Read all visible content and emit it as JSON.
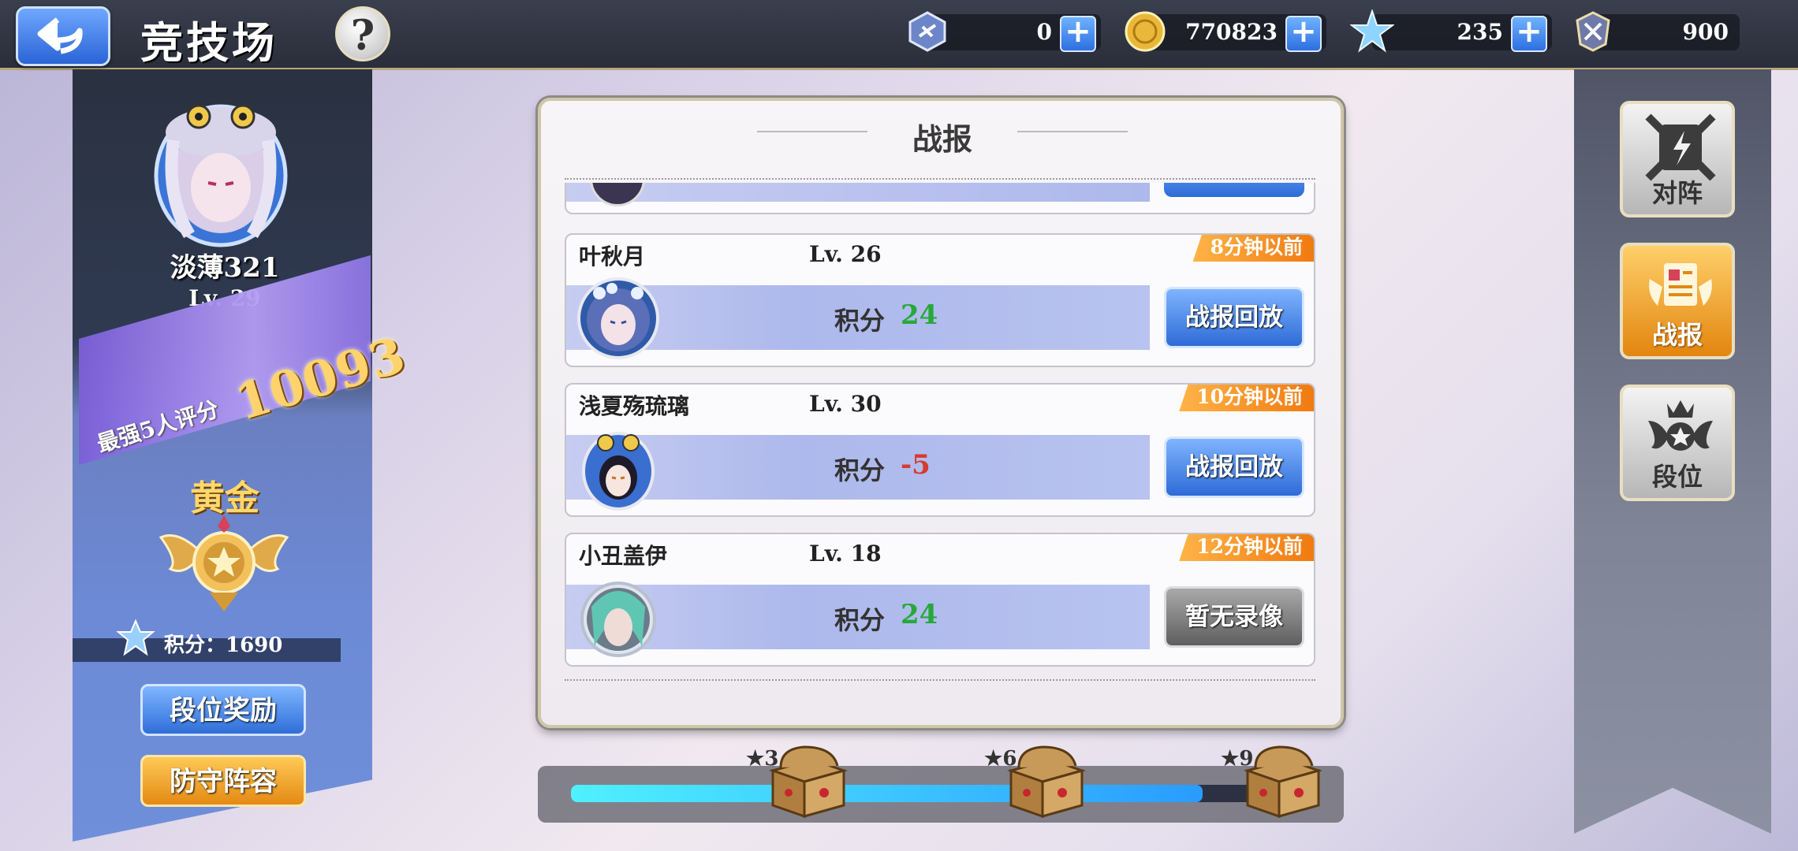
{
  "header": {
    "title": "竞技场",
    "help_label": "?",
    "resources": [
      {
        "icon": "arena-ticket-icon",
        "value": "0"
      },
      {
        "icon": "gold-coin-icon",
        "value": "770823"
      },
      {
        "icon": "star-crystal-icon",
        "value": "235"
      },
      {
        "icon": "arena-medal-icon",
        "value": "900"
      }
    ]
  },
  "player": {
    "name": "淡薄321",
    "level": "Lv. 29",
    "power_label": "最强5人评分",
    "power_value": "10093",
    "rank_name": "黄金",
    "score_text": "积分：1690",
    "rank_reward_label": "段位奖励",
    "defense_label": "防守阵容"
  },
  "panel": {
    "title": "战报",
    "entries": [
      {
        "name": "叶秋月",
        "level": "Lv. 26",
        "time": "8分钟以前",
        "score_label": "积分",
        "score": "24",
        "button": "战报回放"
      },
      {
        "name": "浅夏殇琉璃",
        "level": "Lv. 30",
        "time": "10分钟以前",
        "score_label": "积分",
        "score": "-5",
        "button": "战报回放"
      },
      {
        "name": "小丑盖伊",
        "level": "Lv. 18",
        "time": "12分钟以前",
        "score_label": "积分",
        "score": "24",
        "button": "暂无录像"
      }
    ]
  },
  "progress": {
    "fraction": 0.89,
    "milestones": [
      "3",
      "6",
      "9"
    ]
  },
  "side_nav": {
    "items": [
      {
        "label": "对阵",
        "active": false
      },
      {
        "label": "战报",
        "active": true
      },
      {
        "label": "段位",
        "active": false
      }
    ]
  },
  "colors": {
    "accent_blue": "#2e6bd6",
    "accent_gold": "#e38a14",
    "score_positive": "#27a83a",
    "score_negative": "#d63b2f",
    "time_badge": "#f07a10"
  }
}
